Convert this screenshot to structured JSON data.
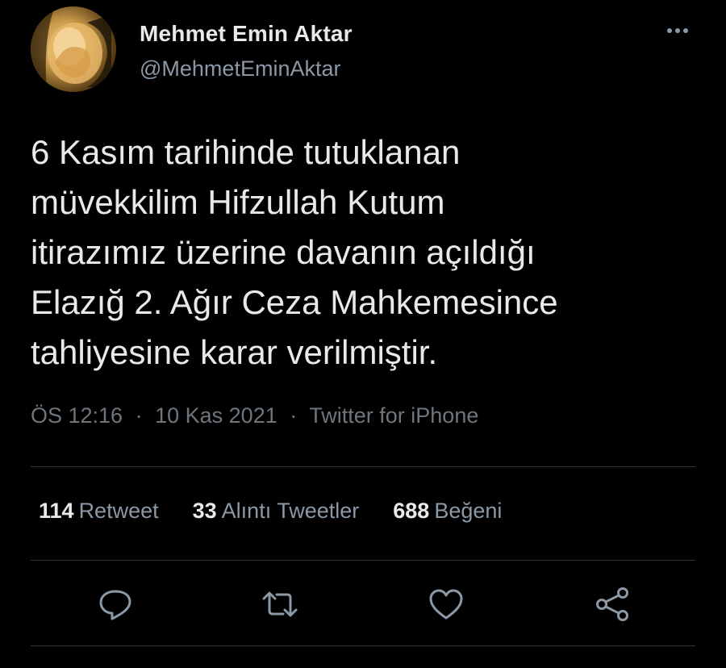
{
  "author": {
    "name": "Mehmet Emin Aktar",
    "handle": "@MehmetEminAktar",
    "avatar_icon": "user-avatar-photo"
  },
  "tweet": {
    "text": "6 Kasım tarihinde tutuklanan\nmüvekkilim Hifzullah Kutum\nitirazımız üzerine davanın açıldığı\nElazığ 2. Ağır Ceza Mahkemesince\ntahliyesine karar verilmiştir."
  },
  "meta": {
    "time": "ÖS 12:16",
    "separator": "·",
    "date": "10 Kas 2021",
    "source": "Twitter for iPhone"
  },
  "stats": [
    {
      "count": "114",
      "label": "Retweet"
    },
    {
      "count": "33",
      "label": "Alıntı Tweetler"
    },
    {
      "count": "688",
      "label": "Beğeni"
    }
  ],
  "actions": {
    "reply_icon": "reply-icon",
    "retweet_icon": "retweet-icon",
    "like_icon": "heart-icon",
    "share_icon": "share-icon",
    "more_icon": "more-dots-icon"
  },
  "colors": {
    "background": "#000000",
    "primary_text": "#e7e9ea",
    "secondary_text": "#8b98a5",
    "meta_text": "#6e767d",
    "divider": "#2f3336"
  }
}
